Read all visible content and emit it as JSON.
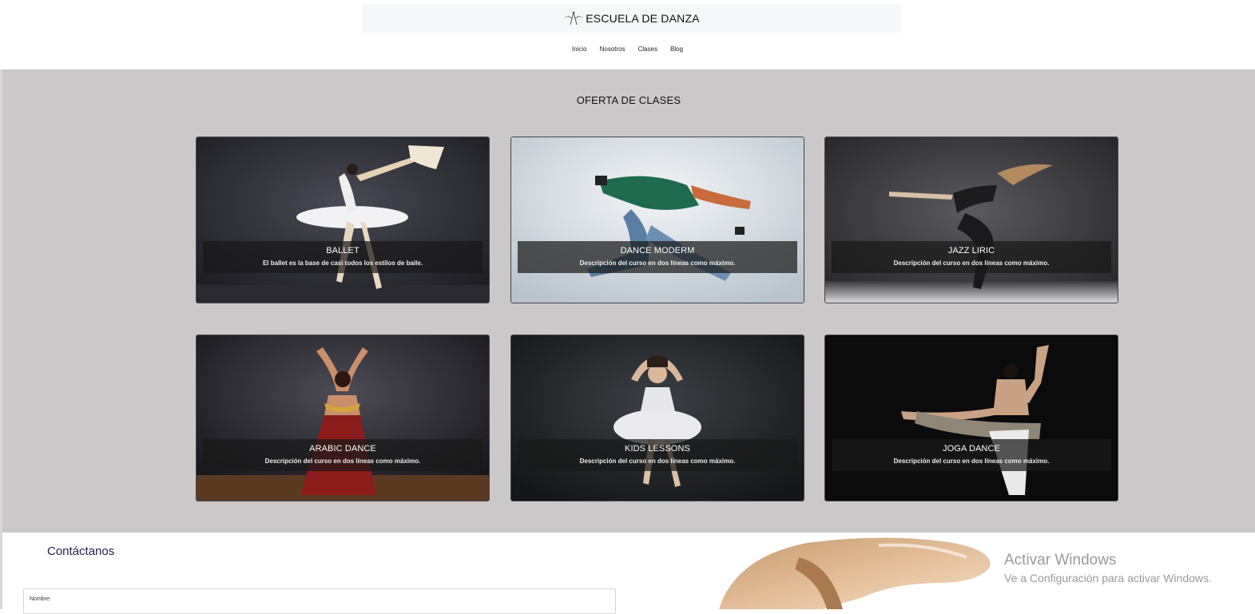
{
  "header": {
    "title": "ESCUELA DE DANZA",
    "nav": [
      "Inicio",
      "Nosotros",
      "Clases",
      "Blog"
    ]
  },
  "classes": {
    "title": "OFERTA DE CLASES",
    "cards": [
      {
        "name": "BALLET",
        "desc": "El ballet es la base de casi todos los estilos de baile."
      },
      {
        "name": "DANCE MODERM",
        "desc": "Descripción del curso en dos líneas como máximo."
      },
      {
        "name": "JAZZ LIRIC",
        "desc": "Descripción del curso en dos líneas como máximo."
      },
      {
        "name": "ARABIC DANCE",
        "desc": "Descripción del curso en dos líneas como máximo."
      },
      {
        "name": "KIDS LESSONS",
        "desc": "Descripción del curso en dos líneas como máximo."
      },
      {
        "name": "JOGA DANCE",
        "desc": "Descripción del curso en dos líneas como máximo."
      }
    ]
  },
  "contact": {
    "title": "Contáctanos",
    "fields": [
      {
        "label": "Nombre:"
      }
    ]
  },
  "watermark": {
    "line1": "Activar Windows",
    "line2": "Ve a Configuración para activar Windows."
  },
  "colors": {
    "section_bg": "#cbc8c9",
    "caption_bg": "#191919",
    "contact_title": "#1b1f4a",
    "watermark": "#9a9a9a"
  }
}
